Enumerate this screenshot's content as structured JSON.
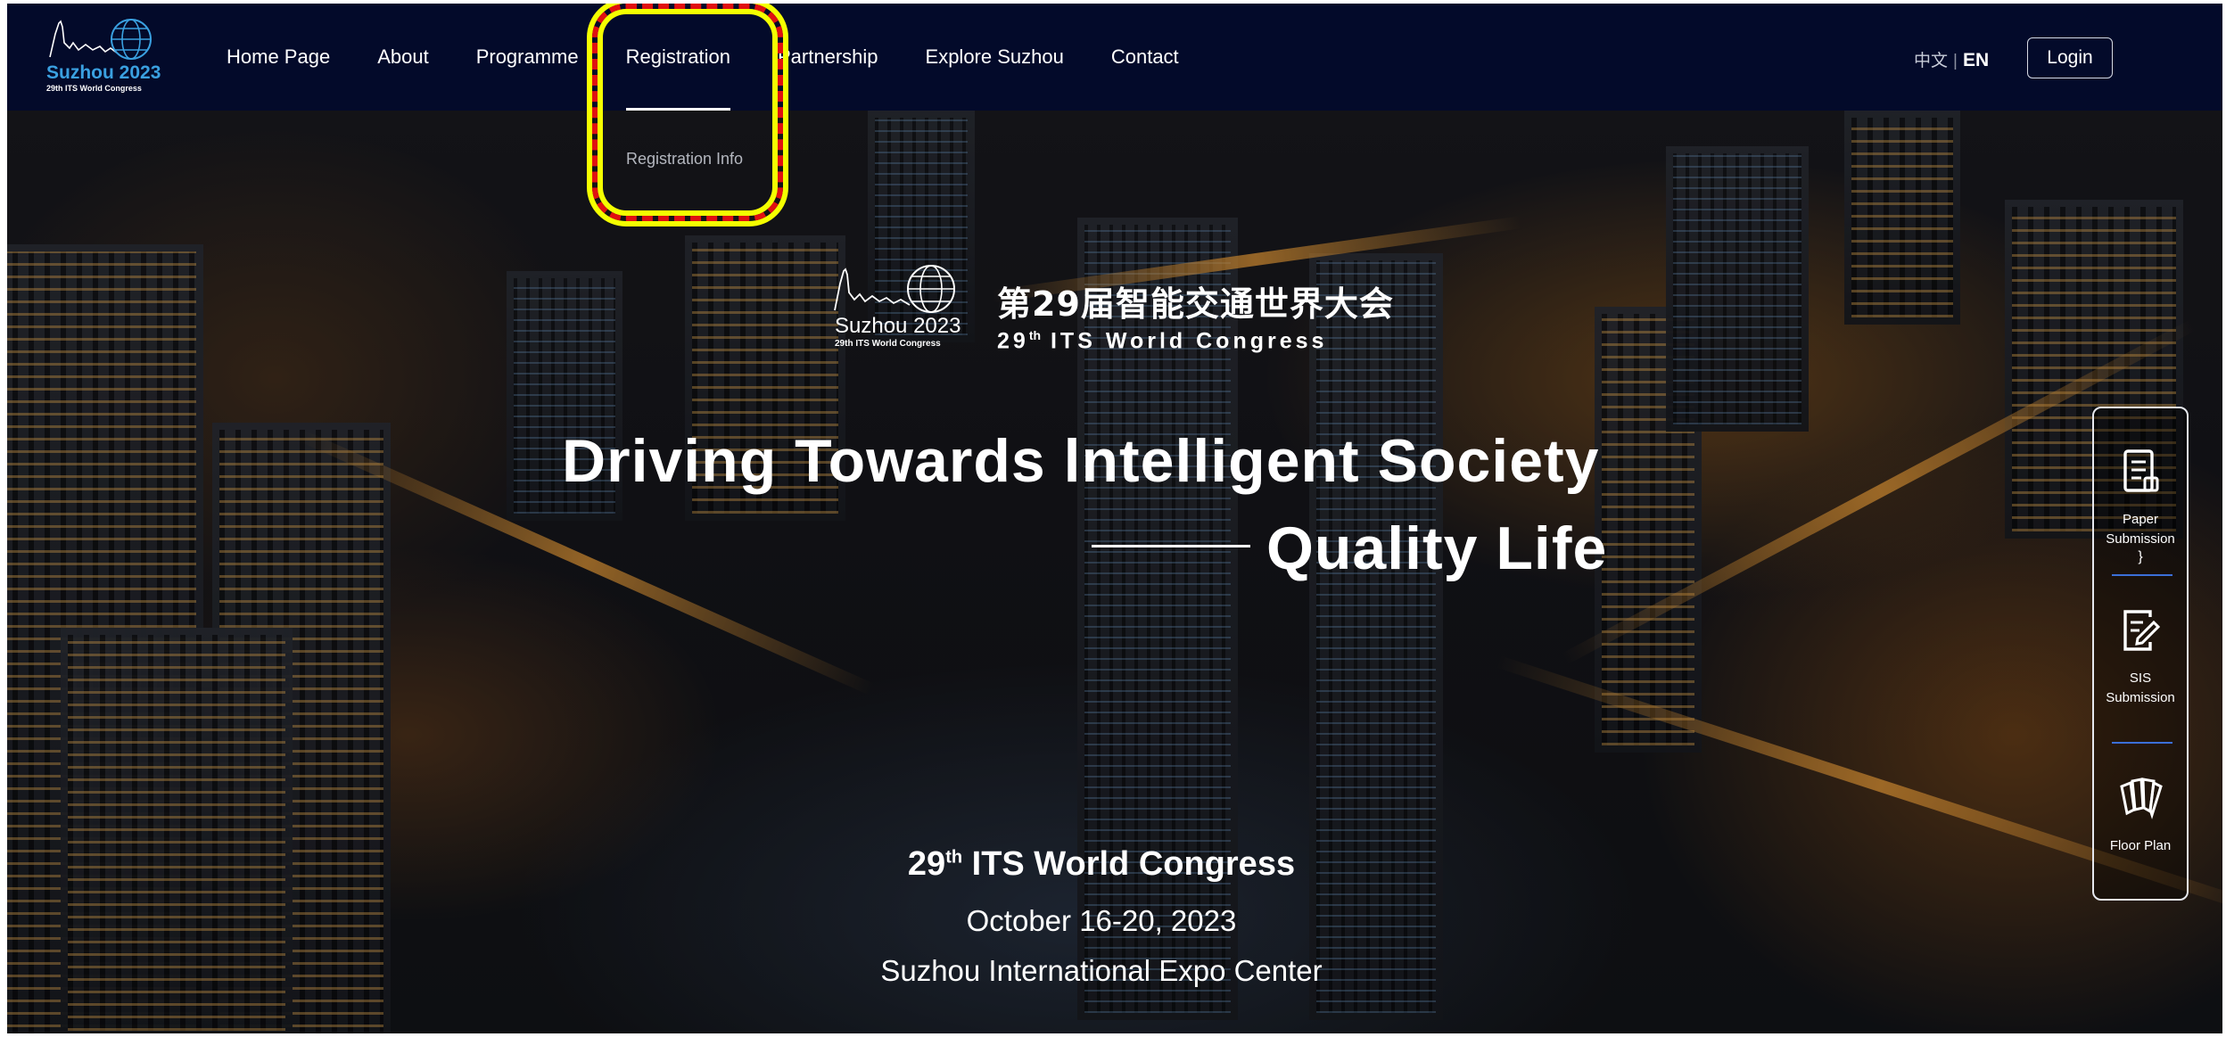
{
  "brand": {
    "logo_text": "Suzhou 2023",
    "logo_sub": "29th ITS World Congress"
  },
  "nav": {
    "items": [
      {
        "label": "Home Page"
      },
      {
        "label": "About"
      },
      {
        "label": "Programme"
      },
      {
        "label": "Registration"
      },
      {
        "label": "Partnership"
      },
      {
        "label": "Explore Suzhou"
      },
      {
        "label": "Contact"
      }
    ],
    "active": "Registration",
    "dropdown": {
      "items": [
        {
          "label": "Registration Info"
        }
      ]
    },
    "lang_cn": "中文",
    "lang_sep": "|",
    "lang_en": "EN",
    "login_label": "Login"
  },
  "hero": {
    "logo_text": "Suzhou 2023",
    "logo_sub": "29th ITS World Congress",
    "cn_title": "第29届智能交通世界大会",
    "en_title_num": "29",
    "en_title_sup": "th",
    "en_title_rest": " ITS World Congress",
    "slogan_line1": "Driving Towards lntelligent Society",
    "slogan_line2": "Quality Life",
    "congress_num": "29",
    "congress_sup": "th",
    "congress_rest": " ITS World Congress",
    "dates": "October 16-20, 2023",
    "venue": "Suzhou International Expo Center"
  },
  "sidebar": {
    "items": [
      {
        "label_1": "Paper",
        "label_2": "Submission",
        "icon": "paper-icon"
      },
      {
        "label_1": "SIS",
        "label_2": "Submission",
        "icon": "edit-document-icon"
      },
      {
        "label_1": "Floor Plan",
        "label_2": "",
        "icon": "floor-plan-icon"
      }
    ]
  },
  "colors": {
    "nav_bg": "#030a2a",
    "sidebar_divider": "#3b6fd8",
    "highlight_border": "#e01010",
    "highlight_glow": "#f4ff00"
  }
}
